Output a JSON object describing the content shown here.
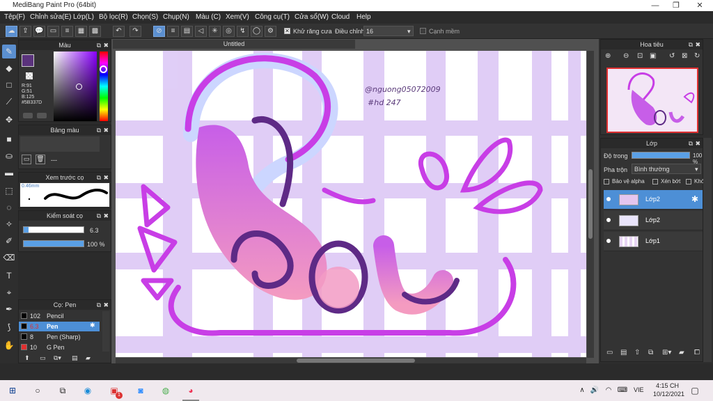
{
  "window": {
    "title": "MediBang Paint Pro (64bit)",
    "minimize": "—",
    "restore": "❐",
    "close": "✕"
  },
  "menu": [
    "Tệp(F)",
    "Chỉnh sửa(E)",
    "Lớp(L)",
    "Bộ lọc(R)",
    "Chọn(S)",
    "Chụp(N)",
    "Màu (C)",
    "Xem(V)",
    "Công cụ(T)",
    "Cửa sổ(W)",
    "Cloud",
    "Help"
  ],
  "toolbar": {
    "antialias_label": "Khử răng cưa",
    "adjust_label": "Điều chỉnh",
    "adjust_value": "16",
    "edge_label": "Cạnh mềm"
  },
  "color_panel": {
    "title": "Màu",
    "r": "R:91",
    "g": "G:51",
    "b": "B:125",
    "hex": "#5B337D",
    "color": "#5b337d"
  },
  "palette_panel": {
    "title": "Bảng màu",
    "dash": "---"
  },
  "brush_preview": {
    "title": "Xem trước cọ",
    "size": "0.46mm"
  },
  "brush_control": {
    "title": "Kiểm soát cọ",
    "size": "6.3",
    "opacity": "100 %",
    "size_fraction": 0.08,
    "opacity_fraction": 1.0
  },
  "brush_list": {
    "title": "Cọ: Pen",
    "items": [
      {
        "size": "102",
        "name": "Pencil",
        "color": "#000000"
      },
      {
        "size": "6.3",
        "name": "Pen",
        "color": "#000000"
      },
      {
        "size": "8",
        "name": "Pen (Sharp)",
        "color": "#000000"
      },
      {
        "size": "10",
        "name": "G Pen",
        "color": "#e03030"
      }
    ]
  },
  "canvas": {
    "tab": "Untitled",
    "credit_line1": "@nguong05072009",
    "credit_line2": "#hd 247"
  },
  "navigator": {
    "title": "Hoa tiêu"
  },
  "layer_panel": {
    "title": "Lớp",
    "opacity_label": "Độ trong",
    "opacity_value": "100 %",
    "opacity_fraction": 1.0,
    "blend_label": "Pha trộn",
    "blend_value": "Bình thường",
    "protect_alpha": "Bảo vệ alpha",
    "clip": "Xén bớt",
    "lock": "Khóa",
    "layers": [
      {
        "name": "Lớp2"
      },
      {
        "name": "Lớp2"
      },
      {
        "name": "Lớp1"
      }
    ]
  },
  "taskbar": {
    "lang": "VIE",
    "time": "4:15 CH",
    "date": "10/12/2021",
    "badge": "1"
  }
}
